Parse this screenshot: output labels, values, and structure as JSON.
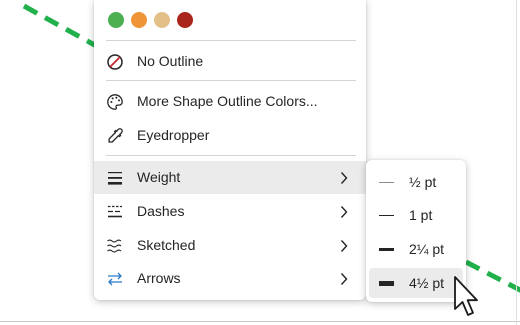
{
  "colors": {
    "dashed_line": "#22b04c",
    "menu_bg": "#ffffff",
    "hover_bg": "#ebebeb",
    "no_outline_icon": "#c4262e",
    "arrows_icon": "#2a7ac9"
  },
  "palette": [
    {
      "name": "green",
      "color": "#4caf50"
    },
    {
      "name": "orange",
      "color": "#ef9537"
    },
    {
      "name": "tan",
      "color": "#e2c088"
    },
    {
      "name": "dark-red",
      "color": "#a8261c"
    }
  ],
  "menu": {
    "no_outline": {
      "label": "No Outline",
      "icon": "no-outline-icon"
    },
    "more_colors": {
      "label": "More Shape Outline Colors...",
      "icon": "palette-icon"
    },
    "eyedropper": {
      "label": "Eyedropper",
      "icon": "eyedropper-icon"
    },
    "weight": {
      "label": "Weight",
      "icon": "weight-icon",
      "state": "hovered",
      "has_submenu": true
    },
    "dashes": {
      "label": "Dashes",
      "icon": "dashes-icon",
      "has_submenu": true
    },
    "sketched": {
      "label": "Sketched",
      "icon": "sketched-icon",
      "has_submenu": true
    },
    "arrows": {
      "label": "Arrows",
      "icon": "arrows-icon",
      "has_submenu": true
    }
  },
  "weight_submenu": {
    "items": [
      {
        "label": "½ pt"
      },
      {
        "label": "1 pt"
      },
      {
        "label": "2¼ pt"
      },
      {
        "label": "4½ pt",
        "state": "hovered"
      }
    ]
  }
}
